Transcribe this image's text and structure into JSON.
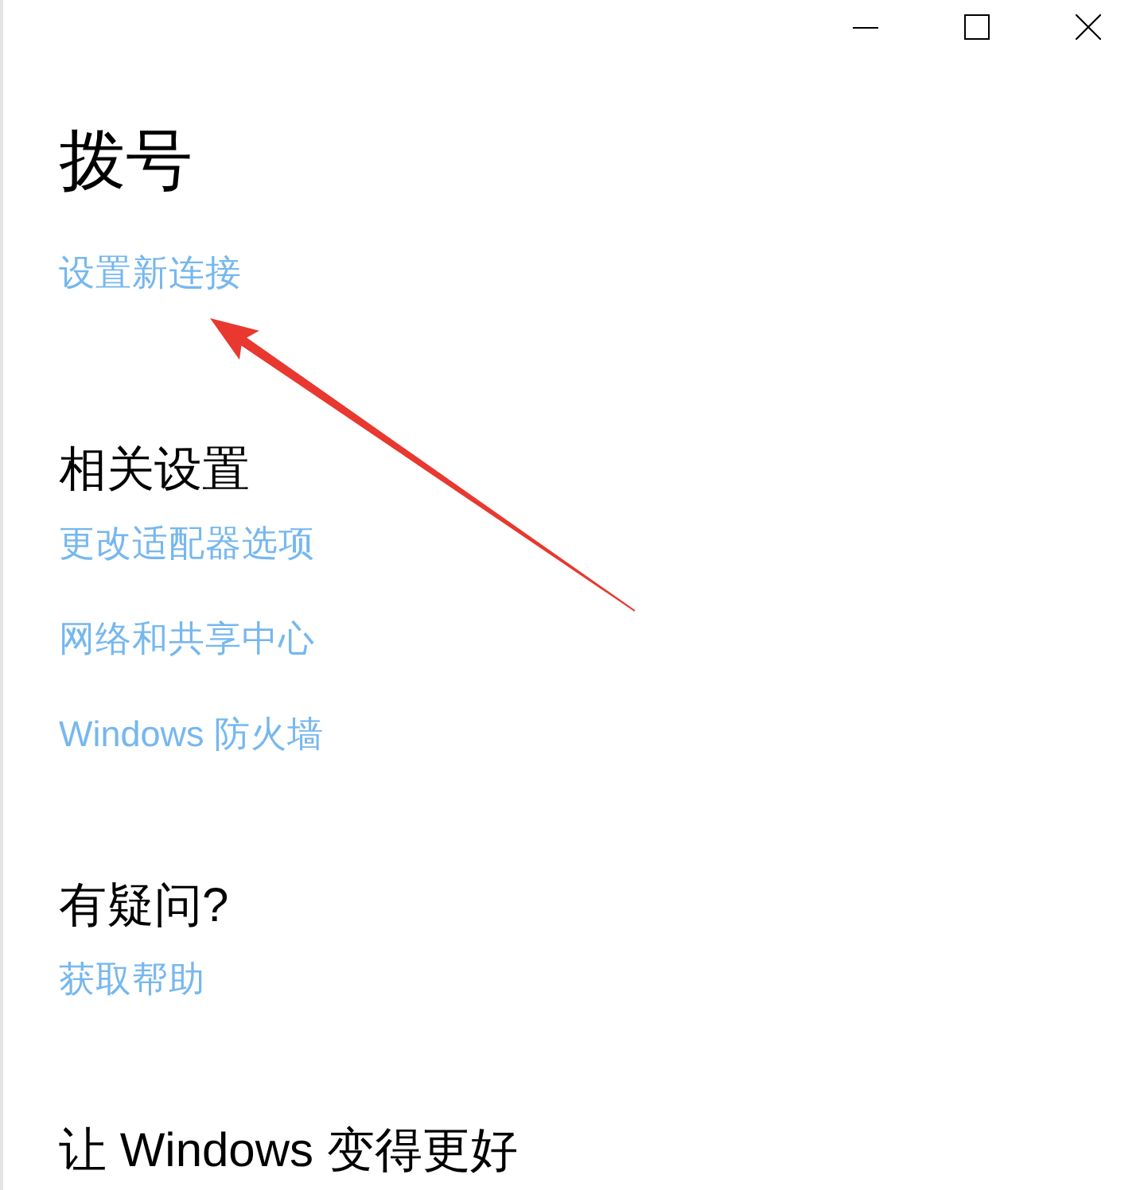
{
  "page": {
    "title": "拨号",
    "links": [
      "设置新连接"
    ]
  },
  "sections": [
    {
      "heading": "相关设置",
      "links": [
        "更改适配器选项",
        "网络和共享中心",
        "Windows 防火墙"
      ]
    },
    {
      "heading": "有疑问?",
      "links": [
        "获取帮助"
      ]
    },
    {
      "heading": "让 Windows 变得更好"
    }
  ]
}
